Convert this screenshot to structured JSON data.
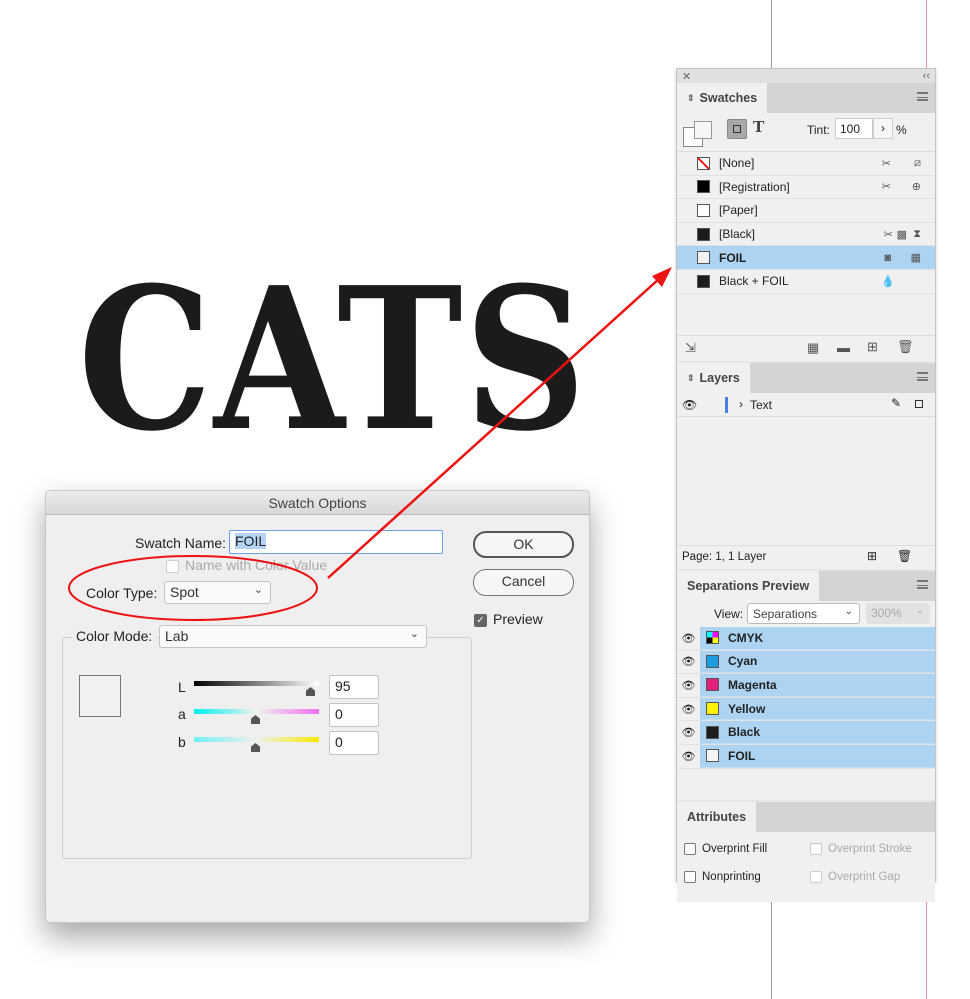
{
  "canvas": {
    "text": "CATS"
  },
  "panel": {
    "swatches": {
      "tab": "Swatches",
      "tint_label": "Tint:",
      "tint_value": "100",
      "percent": "%",
      "items": [
        {
          "name": "[None]",
          "color": "none"
        },
        {
          "name": "[Registration]",
          "color": "#000000"
        },
        {
          "name": "[Paper]",
          "color": "#ffffff"
        },
        {
          "name": "[Black]",
          "color": "#1c1c1c"
        },
        {
          "name": "FOIL",
          "color": "#f2f2f2",
          "selected": true
        },
        {
          "name": "Black + FOIL",
          "color": "#1c1c1c"
        }
      ]
    },
    "layers": {
      "tab": "Layers",
      "items": [
        {
          "name": "Text"
        }
      ],
      "status": "Page: 1, 1 Layer"
    },
    "separations": {
      "tab": "Separations Preview",
      "view_label": "View:",
      "view_value": "Separations",
      "zoom_value": "300%",
      "items": [
        {
          "name": "CMYK",
          "color": "cmyk"
        },
        {
          "name": "Cyan",
          "color": "#1a9ee0"
        },
        {
          "name": "Magenta",
          "color": "#e0227a"
        },
        {
          "name": "Yellow",
          "color": "#fff200"
        },
        {
          "name": "Black",
          "color": "#1c1c1c"
        },
        {
          "name": "FOIL",
          "color": "#f4f4f4"
        }
      ]
    },
    "attributes": {
      "tab": "Attributes",
      "overprint_fill": "Overprint Fill",
      "overprint_stroke": "Overprint Stroke",
      "nonprinting": "Nonprinting",
      "overprint_gap": "Overprint Gap"
    }
  },
  "dialog": {
    "title": "Swatch Options",
    "swatch_name_label": "Swatch Name:",
    "swatch_name_value": "FOIL",
    "name_with_color_value": "Name with Color Value",
    "color_type_label": "Color Type:",
    "color_type_value": "Spot",
    "color_mode_label": "Color Mode:",
    "color_mode_value": "Lab",
    "L_label": "L",
    "L_value": "95",
    "a_label": "a",
    "a_value": "0",
    "b_label": "b",
    "b_value": "0",
    "ok": "OK",
    "cancel": "Cancel",
    "preview": "Preview",
    "preview_checked": true
  },
  "annotation_color": "#ee1111"
}
